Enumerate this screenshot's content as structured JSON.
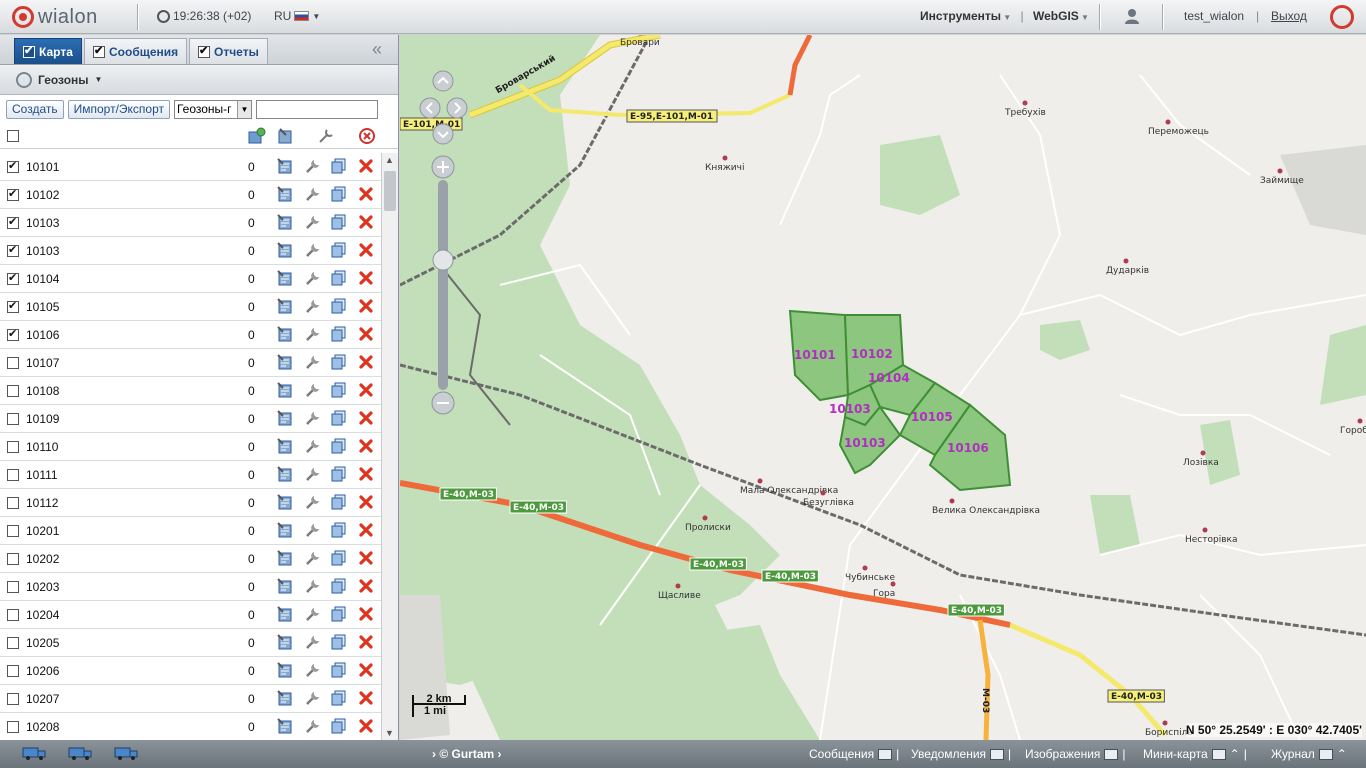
{
  "header": {
    "logo": "wialon",
    "time": "19:26:38 (+02)",
    "lang": "RU",
    "tools": "Инструменты",
    "webgis": "WebGIS",
    "username": "test_wialon",
    "logout": "Выход"
  },
  "tabs": [
    {
      "label": "Карта",
      "checked": true,
      "active": true
    },
    {
      "label": "Сообщения",
      "checked": true,
      "active": false
    },
    {
      "label": "Отчеты",
      "checked": true,
      "active": false
    }
  ],
  "panel": {
    "section": "Геозоны",
    "create_btn": "Создать",
    "import_btn": "Импорт/Экспорт",
    "filter_select": "Геозоны-г"
  },
  "geofences": [
    {
      "name": "10101",
      "count": "0",
      "checked": true
    },
    {
      "name": "10102",
      "count": "0",
      "checked": true
    },
    {
      "name": "10103",
      "count": "0",
      "checked": true
    },
    {
      "name": "10103",
      "count": "0",
      "checked": true
    },
    {
      "name": "10104",
      "count": "0",
      "checked": true
    },
    {
      "name": "10105",
      "count": "0",
      "checked": true
    },
    {
      "name": "10106",
      "count": "0",
      "checked": true
    },
    {
      "name": "10107",
      "count": "0",
      "checked": false
    },
    {
      "name": "10108",
      "count": "0",
      "checked": false
    },
    {
      "name": "10109",
      "count": "0",
      "checked": false
    },
    {
      "name": "10110",
      "count": "0",
      "checked": false
    },
    {
      "name": "10111",
      "count": "0",
      "checked": false
    },
    {
      "name": "10112",
      "count": "0",
      "checked": false
    },
    {
      "name": "10201",
      "count": "0",
      "checked": false
    },
    {
      "name": "10202",
      "count": "0",
      "checked": false
    },
    {
      "name": "10203",
      "count": "0",
      "checked": false
    },
    {
      "name": "10204",
      "count": "0",
      "checked": false
    },
    {
      "name": "10205",
      "count": "0",
      "checked": false
    },
    {
      "name": "10206",
      "count": "0",
      "checked": false
    },
    {
      "name": "10207",
      "count": "0",
      "checked": false
    },
    {
      "name": "10208",
      "count": "0",
      "checked": false
    }
  ],
  "map": {
    "towns": [
      "Бровари",
      "Требухів",
      "Переможець",
      "Княжичі",
      "Займище",
      "Дударків",
      "Мала Олександрівка",
      "Безуглівка",
      "Велика Олександрівка",
      "Пролиски",
      "Чубинське",
      "Гора",
      "Щасливе",
      "Лозівка",
      "Несторівка",
      "Горобі",
      "Бориспіль"
    ],
    "roads": [
      "Броварський",
      "E-101,M-01",
      "E-95,E-101,M-01",
      "E-40,M-03",
      "E-40,M-03",
      "E-40,M-03",
      "E-40,M-03",
      "E-40,M-03",
      "E-40,M-03",
      "M-03"
    ],
    "geofence_labels": [
      "10101",
      "10102",
      "10104",
      "10103",
      "10105",
      "10103",
      "10106"
    ],
    "scale_km": "2 km",
    "scale_mi": "1 mi",
    "coordinates": "N 50° 25.2549' : E 030° 42.7405'",
    "colors": {
      "geofence_fill": "#8dc77f",
      "geofence_stroke": "#3f8e36",
      "geofence_label": "#b02fc0",
      "highway": "#ee6a3a",
      "road_yellow": "#f4e96a",
      "forest": "#c3dfb9"
    }
  },
  "footer": {
    "brand": "© Gurtam",
    "messages": "Сообщения",
    "notifications": "Уведомления",
    "images": "Изображения",
    "minimap": "Мини-карта",
    "log": "Журнал"
  }
}
